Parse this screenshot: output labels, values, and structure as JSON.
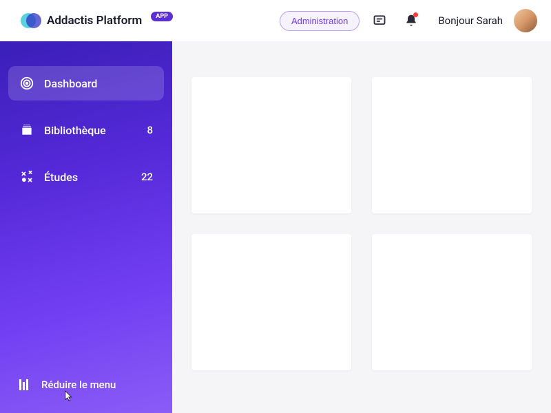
{
  "header": {
    "platform_name": "Addactis Platform",
    "app_badge": "APP",
    "admin_label": "Administration",
    "greeting": "Bonjour Sarah"
  },
  "sidebar": {
    "items": [
      {
        "label": "Dashboard",
        "count": ""
      },
      {
        "label": "Bibliothèque",
        "count": "8"
      },
      {
        "label": "Études",
        "count": "22"
      }
    ],
    "collapse_label": "Réduire le menu"
  }
}
